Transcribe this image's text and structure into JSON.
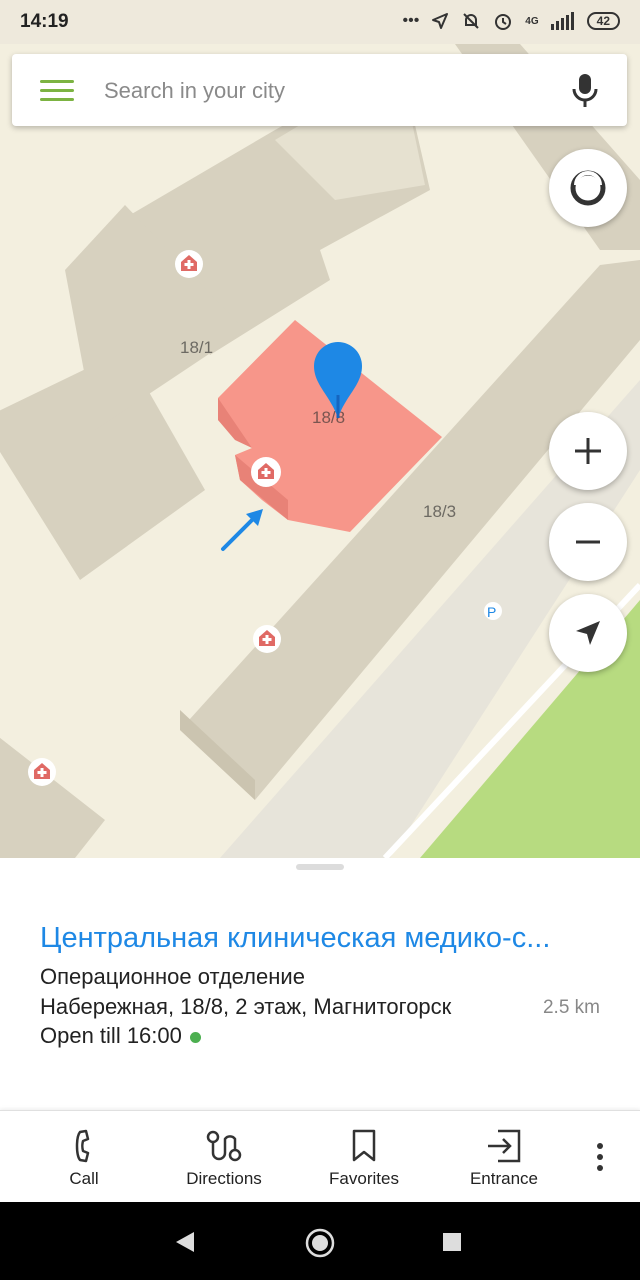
{
  "status_bar": {
    "time": "14:19",
    "network": "4G",
    "battery": "42"
  },
  "search": {
    "placeholder": "Search in your city"
  },
  "map": {
    "labels": [
      "18/1",
      "18/8",
      "18/3"
    ],
    "parking_label": "P",
    "colors": {
      "background": "#f3efdf",
      "building": "#dcd6c4",
      "selected_building": "#f7968a",
      "park": "#b7db80",
      "pin": "#1e88e5"
    }
  },
  "place": {
    "title": "Центральная клиническая медико-с...",
    "subtitle": "Операционное отделение",
    "address": "Набережная, 18/8, 2 этаж, Магнитогорск",
    "distance": "2.5 km",
    "hours": "Open till 16:00"
  },
  "actions": [
    {
      "label": "Call",
      "icon": "phone-icon"
    },
    {
      "label": "Directions",
      "icon": "route-icon"
    },
    {
      "label": "Favorites",
      "icon": "bookmark-icon"
    },
    {
      "label": "Entrance",
      "icon": "entrance-icon"
    }
  ]
}
